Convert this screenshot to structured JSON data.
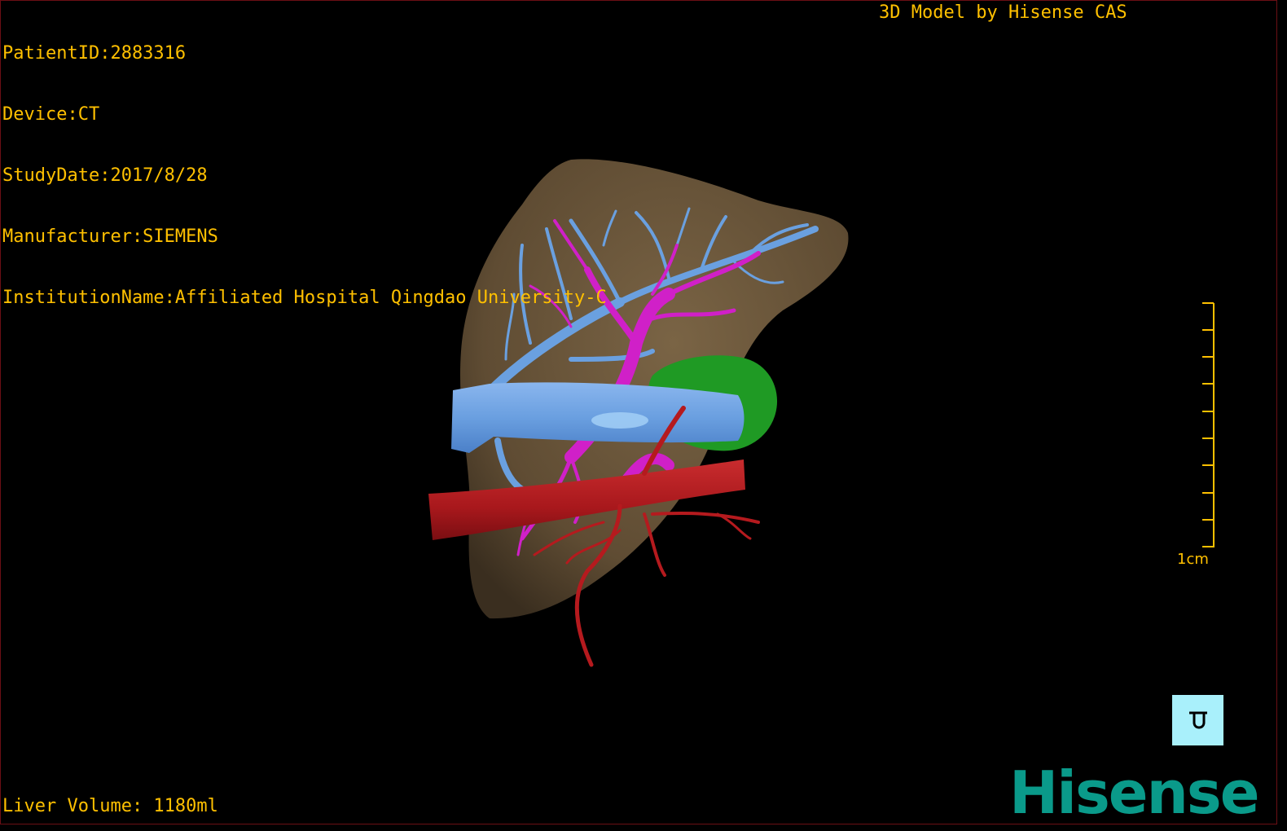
{
  "header": {
    "patient_id": "PatientID:2883316",
    "device": "Device:CT",
    "study_date": "StudyDate:2017/8/28",
    "manufacturer": "Manufacturer:SIEMENS",
    "institution": "InstitutionName:Affiliated Hospital Qingdao University-C"
  },
  "credit": "3D Model by Hisense CAS",
  "footer": {
    "liver_volume": "Liver Volume: 1180ml"
  },
  "scale_bar": {
    "label": "1cm",
    "tick_count": 10
  },
  "orientation_cube": {
    "face_glyph": "ᑌ",
    "icon": "orientation-cube-icon"
  },
  "brand": {
    "logo_text": "Hisense"
  },
  "colors": {
    "overlay_text": "#ffc000",
    "liver": "#6e5a3f",
    "portal_vein": "#6aa0e0",
    "hepatic_vein": "#d020c8",
    "artery": "#b51a1e",
    "tumor": "#1f9a24",
    "brand": "#0a9a8a",
    "cube": "#a9f0fb"
  }
}
